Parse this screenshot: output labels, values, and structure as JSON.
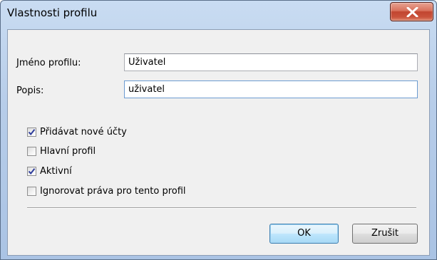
{
  "window": {
    "title": "Vlastnosti profilu",
    "close_label": "X"
  },
  "form": {
    "profile_name": {
      "label": "Jméno profilu:",
      "value": "Uživatel"
    },
    "description": {
      "label": "Popis:",
      "value": "uživatel"
    }
  },
  "options": [
    {
      "label": "Přidávat nové účty",
      "checked": true
    },
    {
      "label": "Hlavní profil",
      "checked": false
    },
    {
      "label": "Aktivní",
      "checked": true
    },
    {
      "label": "Ignorovat práva pro tento profil",
      "checked": false
    }
  ],
  "buttons": {
    "ok_label": "OK",
    "cancel_label": "Zrušit"
  },
  "colors": {
    "title_gradient": "#b7cde9",
    "close_button": "#c24530",
    "default_button_border": "#3c7fb1",
    "checkmark": "#2d3c9b"
  }
}
